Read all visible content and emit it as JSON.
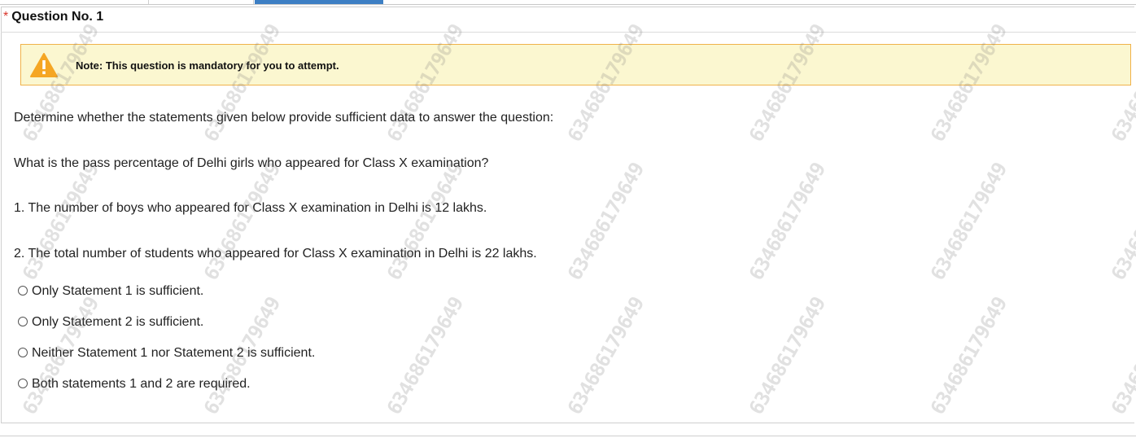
{
  "question": {
    "required_marker": "*",
    "title": "Question No. 1"
  },
  "note": {
    "icon": "warning-icon",
    "text": "Note: This question is mandatory for you to attempt."
  },
  "body": {
    "instruction": "Determine whether the statements given below provide sufficient data to answer the question:",
    "question_text": "What is the pass percentage of Delhi girls who appeared for Class X examination?",
    "statements": [
      "1. The number of boys who appeared for Class X examination in Delhi is 12 lakhs.",
      "2. The total number of students who appeared for Class X examination in Delhi is 22 lakhs."
    ]
  },
  "options": [
    "Only Statement 1 is sufficient.",
    "Only Statement 2 is sufficient.",
    "Neither Statement 1 nor Statement 2 is sufficient.",
    "Both statements 1 and 2 are required."
  ],
  "watermark": "634686179649",
  "colors": {
    "active_tab": "#3d7fc4",
    "note_bg": "#fbf7d0",
    "note_border": "#f0b24a",
    "warning": "#f5a623",
    "required": "#d9352b"
  }
}
